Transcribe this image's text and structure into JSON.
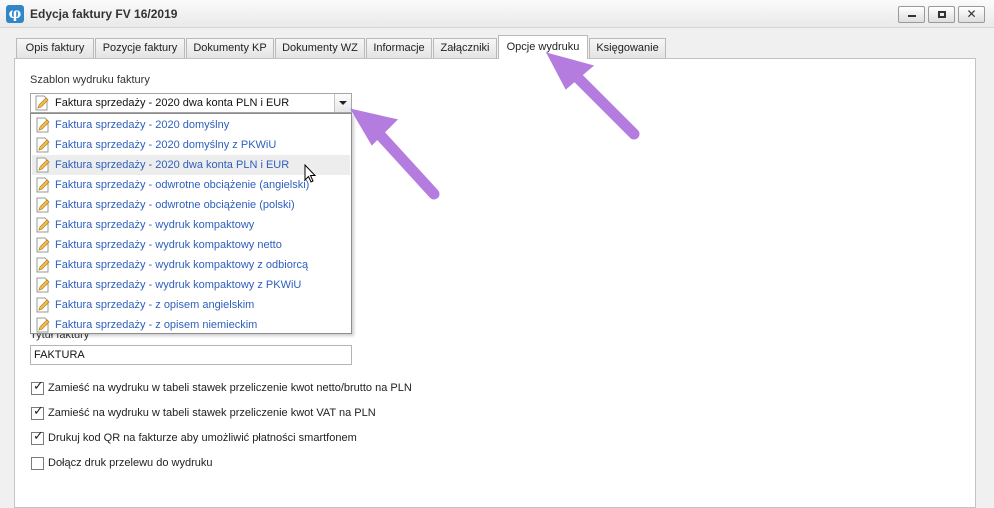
{
  "window": {
    "title": "Edycja faktury FV 16/2019",
    "icon_glyph": "φ",
    "close_glyph": "✕"
  },
  "tabs": [
    {
      "label": "Opis faktury"
    },
    {
      "label": "Pozycje faktury"
    },
    {
      "label": "Dokumenty KP"
    },
    {
      "label": "Dokumenty WZ"
    },
    {
      "label": "Informacje"
    },
    {
      "label": "Załączniki"
    },
    {
      "label": "Opcje wydruku",
      "active": true
    },
    {
      "label": "Księgowanie"
    }
  ],
  "template": {
    "label": "Szablon wydruku faktury",
    "selected": "Faktura sprzedaży - 2020 dwa konta PLN i EUR",
    "options": [
      "Faktura sprzedaży - 2020 domyślny",
      "Faktura sprzedaży - 2020 domyślny z PKWiU",
      "Faktura sprzedaży - 2020 dwa konta PLN i EUR",
      "Faktura sprzedaży - odwrotne obciążenie (angielski)",
      "Faktura sprzedaży - odwrotne obciążenie (polski)",
      "Faktura sprzedaży - wydruk kompaktowy",
      "Faktura sprzedaży - wydruk kompaktowy netto",
      "Faktura sprzedaży - wydruk kompaktowy z odbiorcą",
      "Faktura sprzedaży - wydruk kompaktowy z PKWiU",
      "Faktura sprzedaży - z opisem angielskim",
      "Faktura sprzedaży - z opisem niemieckim"
    ],
    "highlighted_index": 2
  },
  "invoice_title": {
    "label": "Tytuł faktury",
    "value": "FAKTURA"
  },
  "options": [
    {
      "label": "Zamieść na wydruku w tabeli stawek przeliczenie kwot netto/brutto na PLN",
      "checked": true
    },
    {
      "label": "Zamieść na wydruku w tabeli stawek przeliczenie kwot VAT na PLN",
      "checked": true
    },
    {
      "label": "Drukuj kod QR na fakturze aby umożliwić płatności smartfonem",
      "checked": true
    },
    {
      "label": "Dołącz druk przelewu do wydruku",
      "checked": false
    }
  ],
  "colors": {
    "arrow": "#b57ce0",
    "option_text": "#2e5fbe"
  },
  "check_glyph": "✓"
}
